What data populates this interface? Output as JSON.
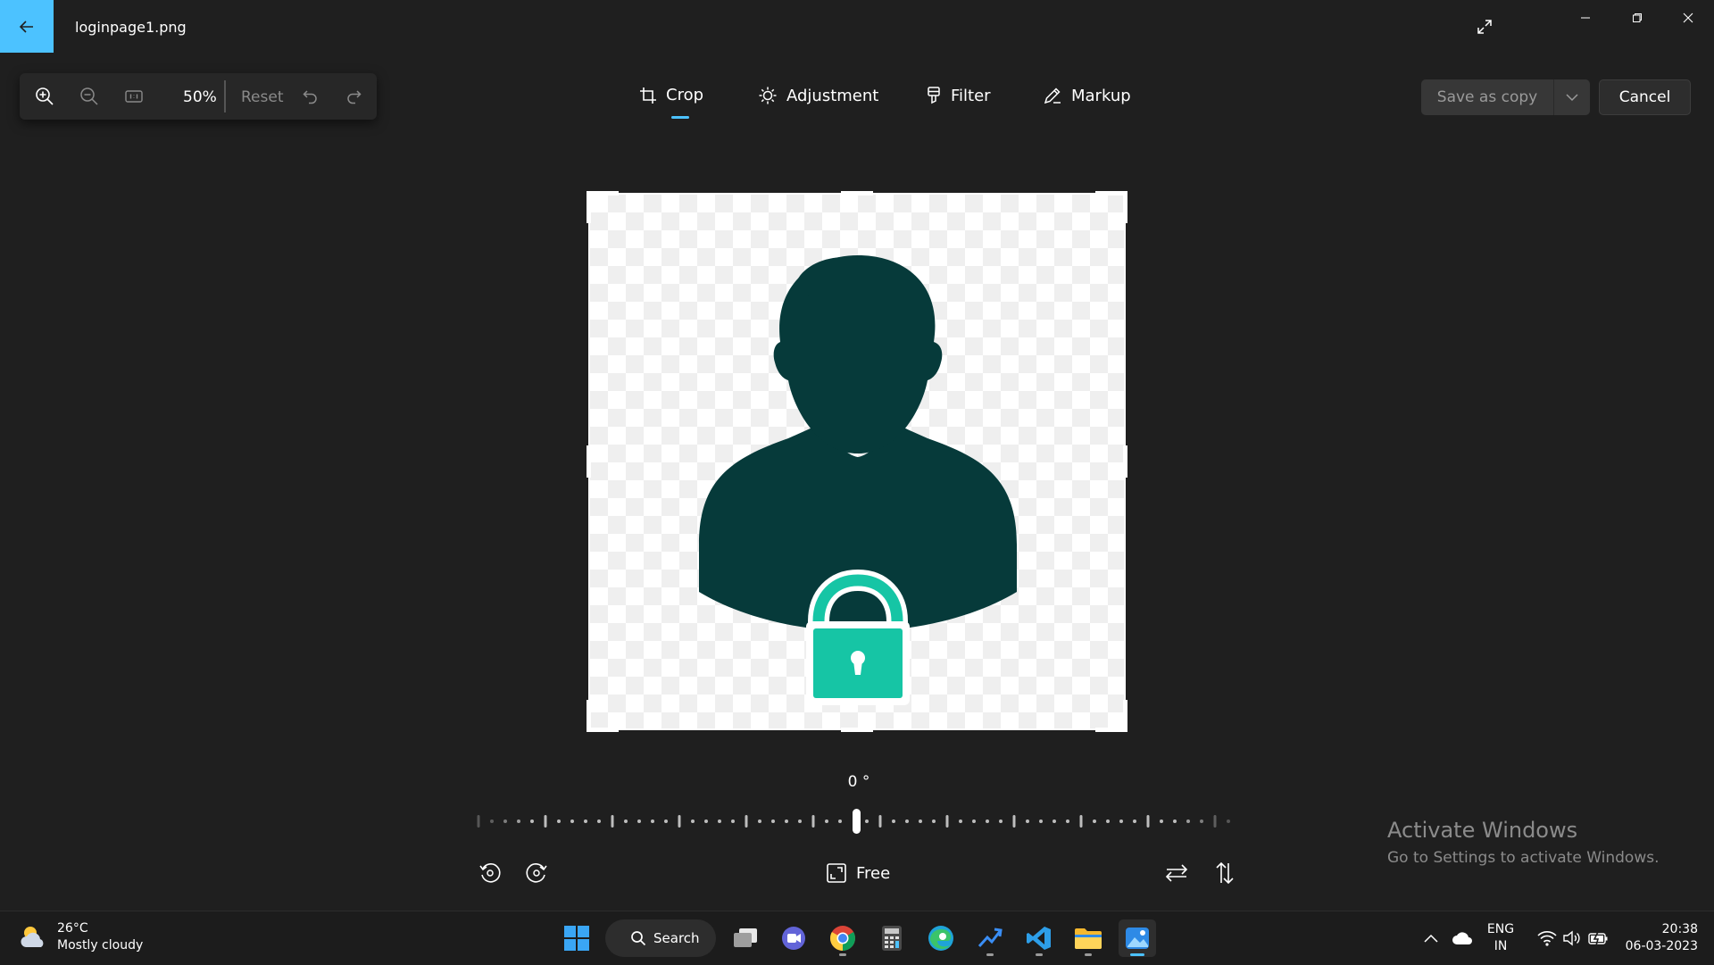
{
  "window": {
    "file_name": "loginpage1.png",
    "back_icon": "arrow-left-icon",
    "controls": [
      "minimize-icon",
      "restore-icon",
      "close-icon"
    ],
    "expand_icon": "expand-diagonal-icon"
  },
  "zoom_toolbar": {
    "zoom_level": "50%",
    "reset_label": "Reset",
    "icons": [
      "zoom-in-icon",
      "zoom-out-icon",
      "actual-size-icon",
      "undo-icon",
      "redo-icon"
    ]
  },
  "tabs": [
    {
      "label": "Crop",
      "icon": "crop-icon",
      "active": true
    },
    {
      "label": "Adjustment",
      "icon": "brightness-icon",
      "active": false
    },
    {
      "label": "Filter",
      "icon": "filter-icon",
      "active": false
    },
    {
      "label": "Markup",
      "icon": "pen-icon",
      "active": false
    }
  ],
  "actions": {
    "save_copy_label": "Save as copy",
    "cancel_label": "Cancel"
  },
  "image": {
    "description_icon": "user-lock-icon",
    "colors": {
      "silhouette": "#063a3a",
      "lock": "#16c5a5"
    }
  },
  "rotation": {
    "value": "0 °",
    "degrees": 0
  },
  "aspect": {
    "label": "Free"
  },
  "watermark": {
    "title": "Activate Windows",
    "subtitle": "Go to Settings to activate Windows."
  },
  "taskbar": {
    "weather_temp": "26°C",
    "weather_desc": "Mostly cloudy",
    "search_label": "Search",
    "lang_1": "ENG",
    "lang_2": "IN",
    "time": "20:38",
    "date": "06-03-2023"
  },
  "colors": {
    "accent": "#4cc2ff",
    "background": "#1f1f1f"
  }
}
